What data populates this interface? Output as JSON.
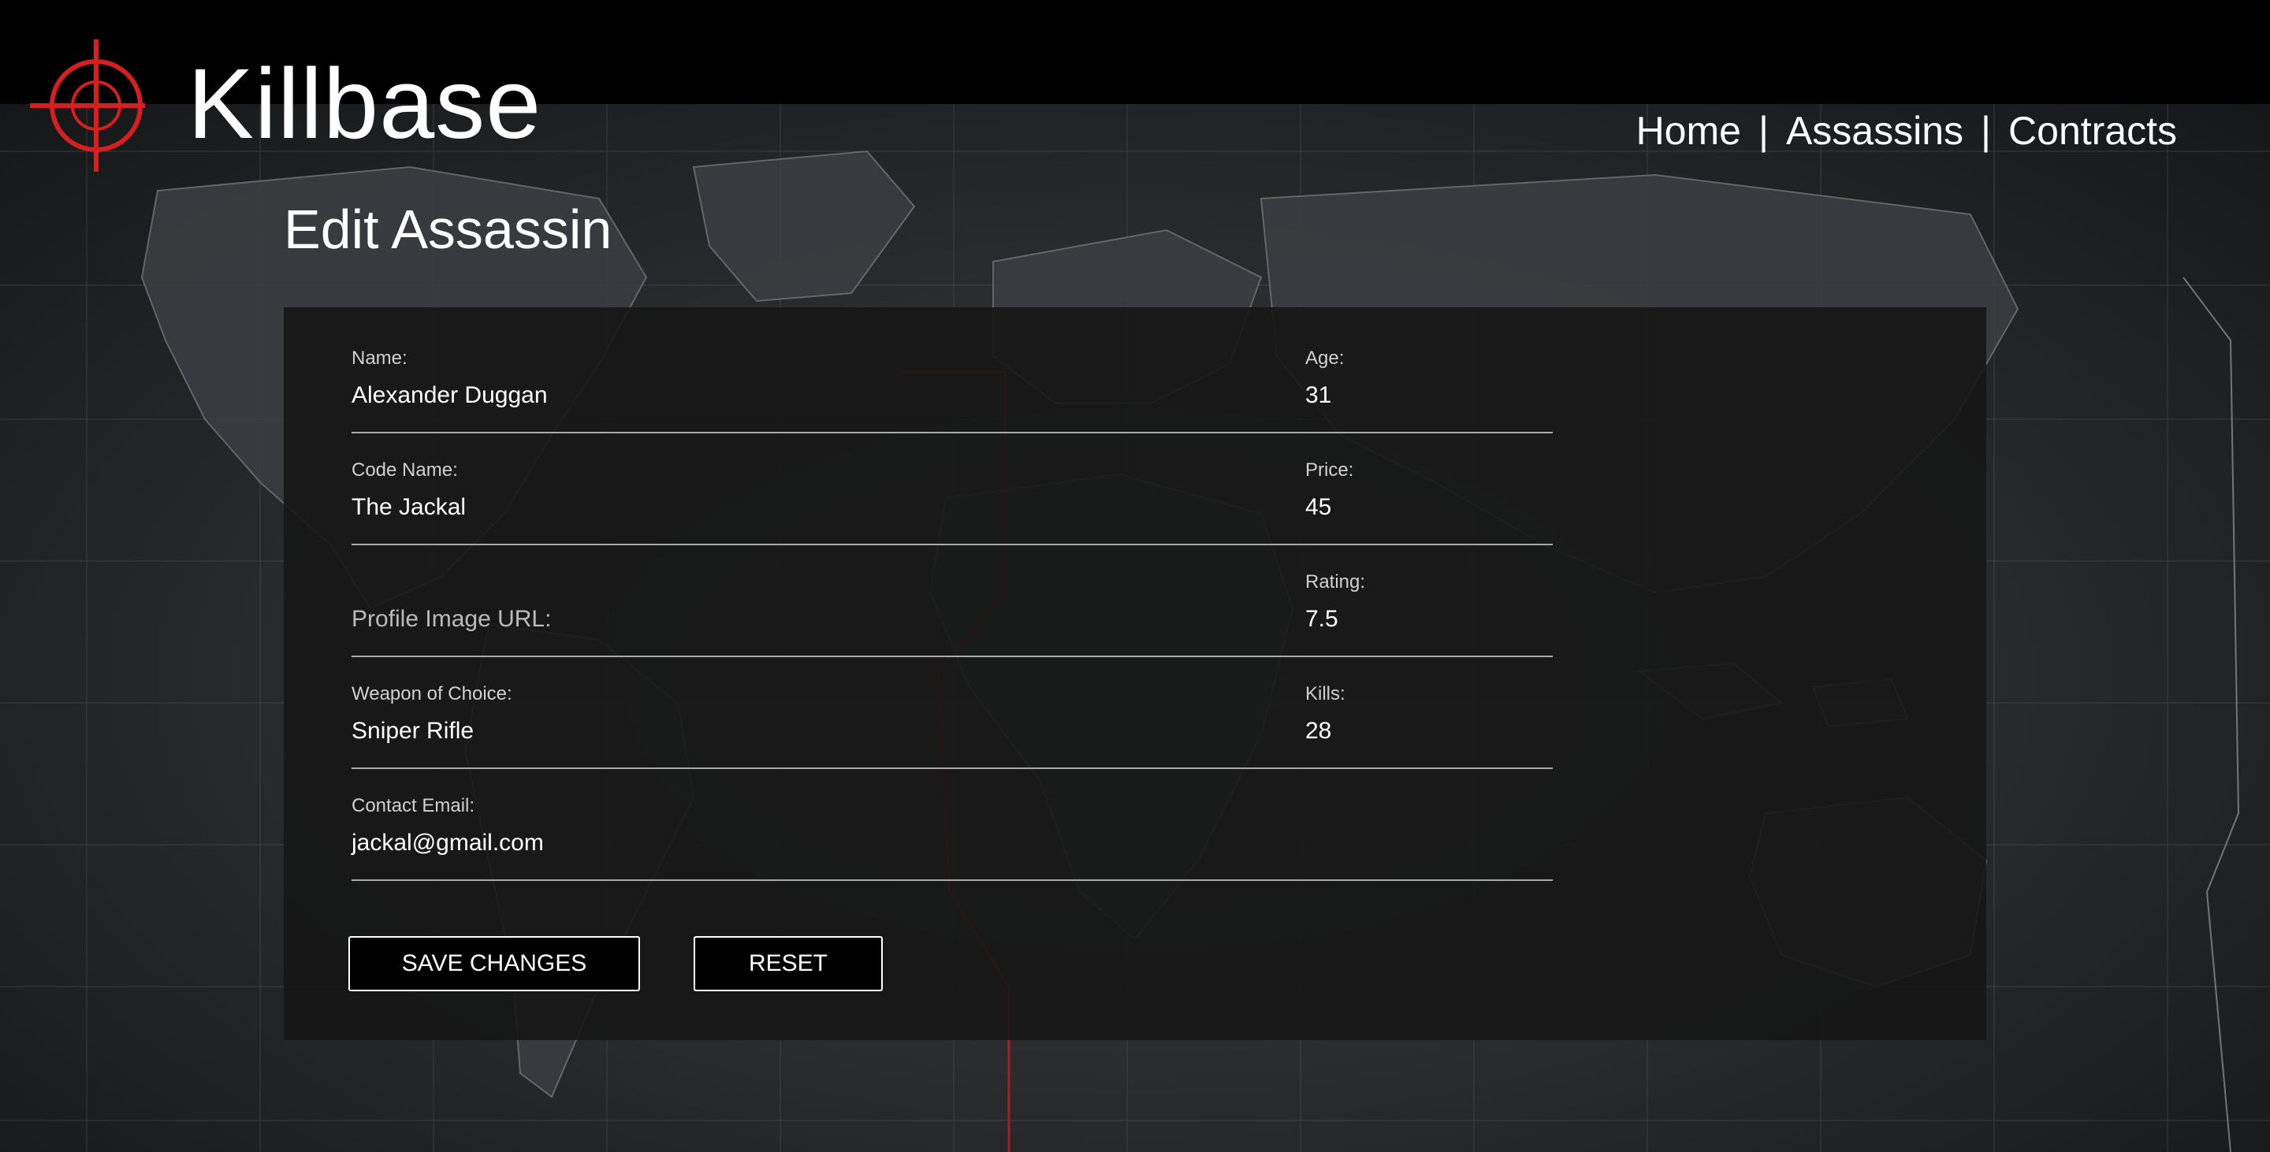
{
  "app": {
    "brand": "Killbase",
    "brand_color": "#d42020"
  },
  "nav": {
    "items": [
      {
        "label": "Home"
      },
      {
        "label": "Assassins"
      },
      {
        "label": "Contracts"
      }
    ],
    "separator": "|"
  },
  "page": {
    "title": "Edit Assassin"
  },
  "form": {
    "name": {
      "label": "Name:",
      "value": "Alexander Duggan"
    },
    "code_name": {
      "label": "Code Name:",
      "value": "The Jackal"
    },
    "profile_image": {
      "placeholder": "Profile Image URL:",
      "value": ""
    },
    "weapon": {
      "label": "Weapon of Choice:",
      "value": "Sniper Rifle"
    },
    "email": {
      "label": "Contact Email:",
      "value": "jackal@gmail.com"
    },
    "age": {
      "label": "Age:",
      "value": "31"
    },
    "price": {
      "label": "Price:",
      "value": "45"
    },
    "rating": {
      "label": "Rating:",
      "value": "7.5"
    },
    "kills": {
      "label": "Kills:",
      "value": "28"
    }
  },
  "buttons": {
    "save": "SAVE CHANGES",
    "reset": "RESET"
  },
  "icons": {
    "logo": "crosshair-icon"
  }
}
